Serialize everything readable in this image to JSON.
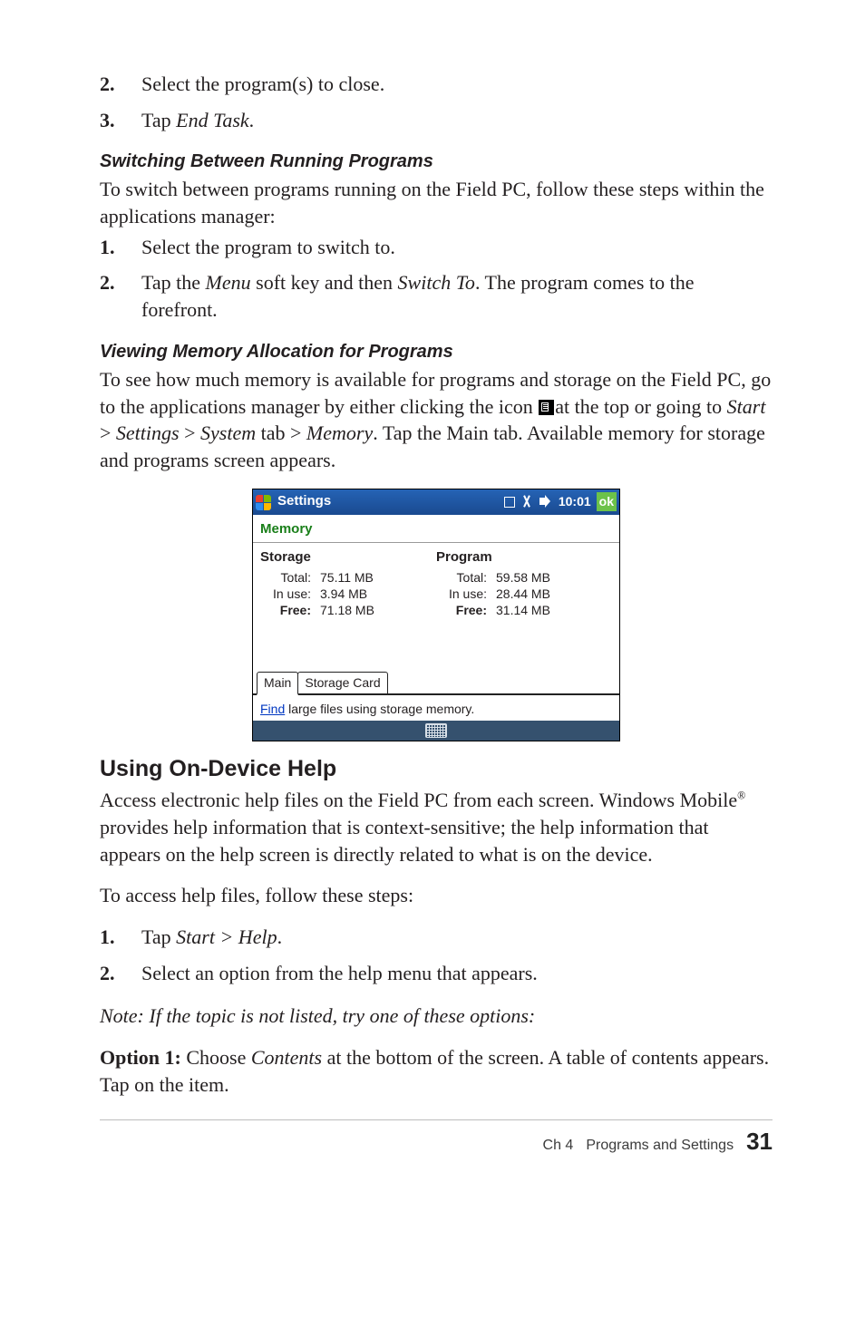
{
  "steps_close": [
    {
      "num": "2.",
      "text_a": "Select the program(s) to close."
    },
    {
      "num": "3.",
      "text_a": "Tap ",
      "italic_b": "End Task",
      "text_c": "."
    }
  ],
  "sub1": "Switching Between Running Programs",
  "para1": "To switch between programs running on the Field PC, follow these steps within the applications manager:",
  "steps_switch": [
    {
      "num": "1.",
      "text_a": "Select the program to switch to."
    },
    {
      "num": "2.",
      "text_a": "Tap the ",
      "italic_b": "Menu",
      "text_c": " soft key and then ",
      "italic_d": "Switch To",
      "text_e": ". The program comes to the forefront."
    }
  ],
  "sub2": "Viewing Memory Allocation for Programs",
  "para2a": "To see how much memory is available for programs and storage on the Field PC, go to the applications manager by either clicking the icon ",
  "para2b": "at the top or going to ",
  "para2_start": "Start",
  "para2_gt1": " > ",
  "para2_settings": "Settings",
  "para2_gt2": " > ",
  "para2_system": "System",
  "para2_tab": " tab > ",
  "para2_memory": "Memory",
  "para2c": ". Tap the Main tab. Available memory for storage and programs screen appears.",
  "screenshot": {
    "title": "Settings",
    "time": "10:01",
    "ok": "ok",
    "memory": "Memory",
    "col1": {
      "title": "Storage",
      "total_k": "Total:",
      "total_v": "75.11 MB",
      "inuse_k": "In use:",
      "inuse_v": "3.94 MB",
      "free_k": "Free:",
      "free_v": "71.18 MB"
    },
    "col2": {
      "title": "Program",
      "total_k": "Total:",
      "total_v": "59.58 MB",
      "inuse_k": "In use:",
      "inuse_v": "28.44 MB",
      "free_k": "Free:",
      "free_v": "31.14 MB"
    },
    "tab1": "Main",
    "tab2": "Storage Card",
    "find_link": "Find",
    "find_text": " large files using storage memory."
  },
  "heading3": "Using On-Device Help",
  "para3a": "Access electronic help files on the Field PC from each screen. Windows Mobile",
  "para3_reg": "®",
  "para3b": " provides help information that is context-sensitive; the help information that appears on the help screen is directly related to what is on the device.",
  "para4": "To access help files, follow these steps:",
  "steps_help": [
    {
      "num": "1.",
      "text_a": "Tap ",
      "italic_b": "Start > Help",
      "text_c": "."
    },
    {
      "num": "2.",
      "text_a": "Select an option from the help menu that appears."
    }
  ],
  "note": "Note: If the topic is not listed, try one of these options:",
  "opt1_label": "Option 1: ",
  "opt1a": "Choose ",
  "opt1_contents": "Contents",
  "opt1b": " at the bottom of the screen. A table of contents appears. Tap on the item.",
  "footer": {
    "ch": "Ch 4",
    "section": "Programs and Settings",
    "page": "31"
  }
}
